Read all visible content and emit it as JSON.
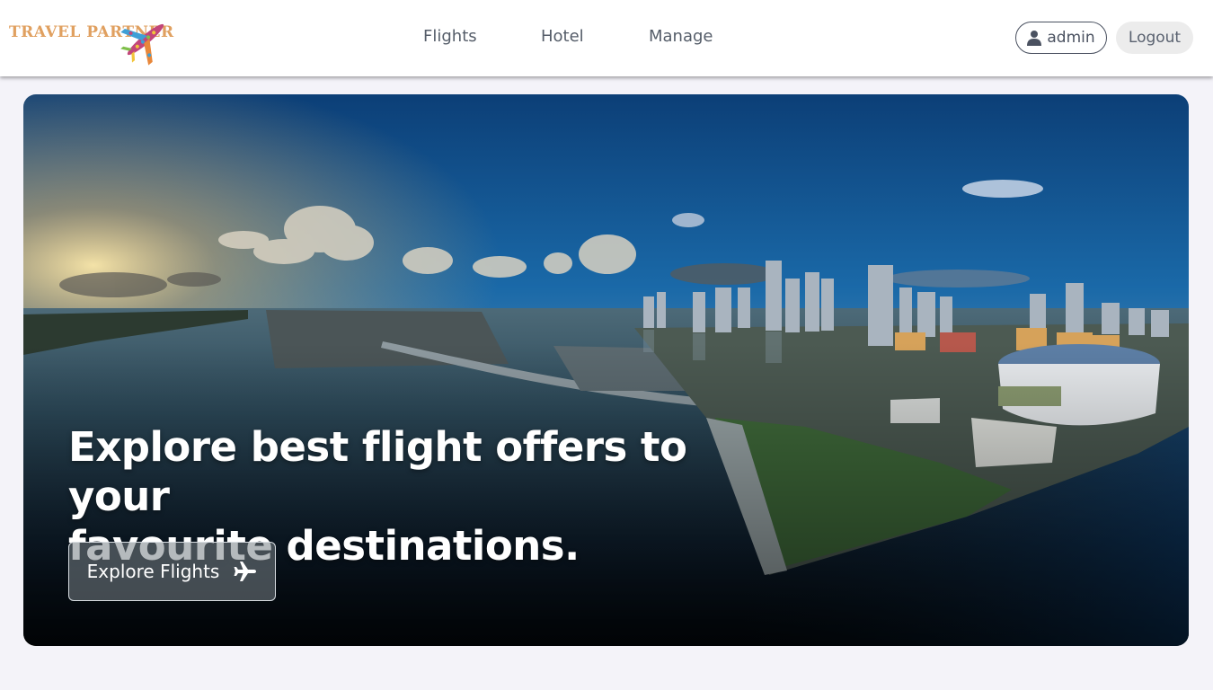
{
  "brand": {
    "name": "TRAVEL PARTNER",
    "logo_icon": "airplane-mosaic-icon"
  },
  "nav": {
    "links": [
      {
        "label": "Flights"
      },
      {
        "label": "Hotel"
      },
      {
        "label": "Manage"
      }
    ]
  },
  "user": {
    "name": "admin",
    "icon": "user-icon"
  },
  "logout": {
    "label": "Logout"
  },
  "hero": {
    "title_line1": "Explore best flight offers to your",
    "title_line2": "favourite destinations.",
    "cta_label": "Explore Flights",
    "cta_icon": "airplane-icon"
  },
  "colors": {
    "navbar_bg": "#ffffff",
    "page_bg": "#f4f3f9",
    "logo_text": "#e0a060",
    "nav_text": "#555d69"
  }
}
